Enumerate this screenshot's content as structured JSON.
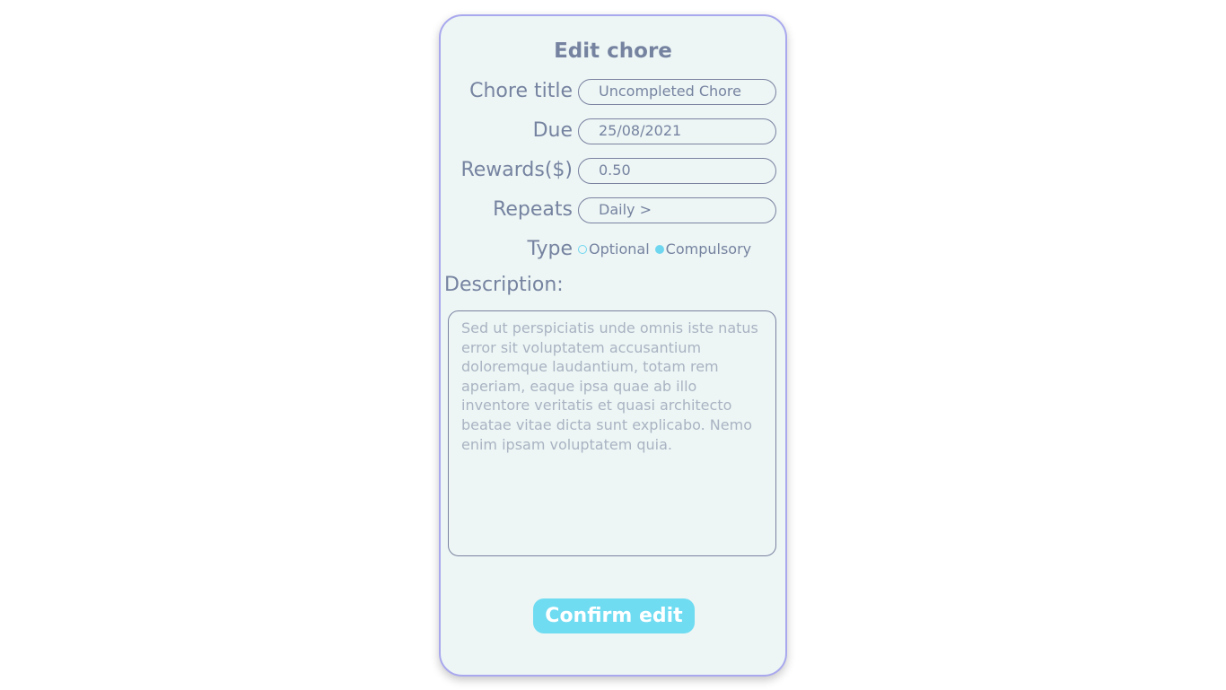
{
  "form": {
    "title": "Edit chore",
    "fields": {
      "chore_title": {
        "label": "Chore title",
        "value": "Uncompleted Chore"
      },
      "due": {
        "label": "Due",
        "value": "25/08/2021"
      },
      "rewards": {
        "label": "Rewards($)",
        "value": "0.50"
      },
      "repeats": {
        "label": "Repeats",
        "value": "Daily >"
      }
    },
    "type": {
      "label": "Type",
      "options": [
        "Optional",
        "Compulsory"
      ],
      "selected": "Compulsory"
    },
    "description": {
      "label": "Description:",
      "placeholder": "Sed ut perspiciatis unde omnis iste natus error sit voluptatem accusantium doloremque laudantium, totam rem aperiam, eaque ipsa quae ab illo inventore veritatis et quasi architecto beatae vitae dicta sunt explicabo. Nemo enim ipsam voluptatem quia."
    },
    "confirm_label": "Confirm edit"
  },
  "colors": {
    "card_bg": "#edf6f5",
    "card_border": "#a9a8ee",
    "text": "#7683a0",
    "accent": "#6fdcf2"
  }
}
